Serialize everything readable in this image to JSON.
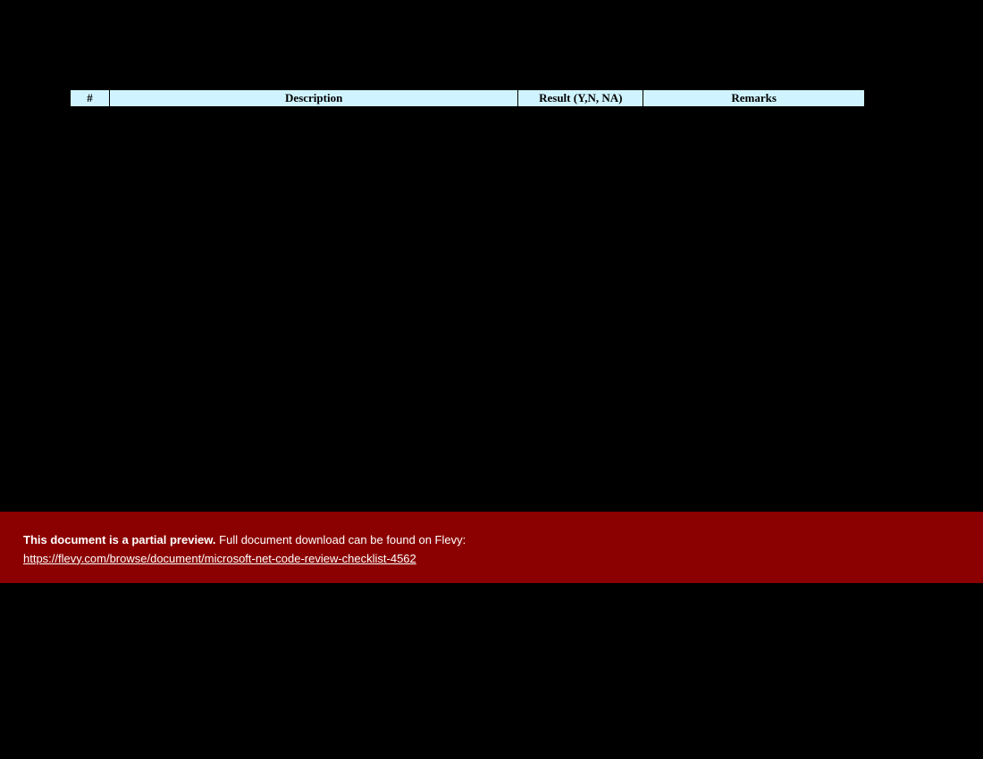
{
  "table": {
    "headers": {
      "num": "#",
      "description": "Description",
      "result": "Result (Y,N, NA)",
      "remarks": "Remarks"
    }
  },
  "banner": {
    "bold_text": "This document is a partial preview.",
    "rest_text": "  Full document download can be found on Flevy:",
    "link_text": "https://flevy.com/browse/document/microsoft-net-code-review-checklist-4562"
  }
}
